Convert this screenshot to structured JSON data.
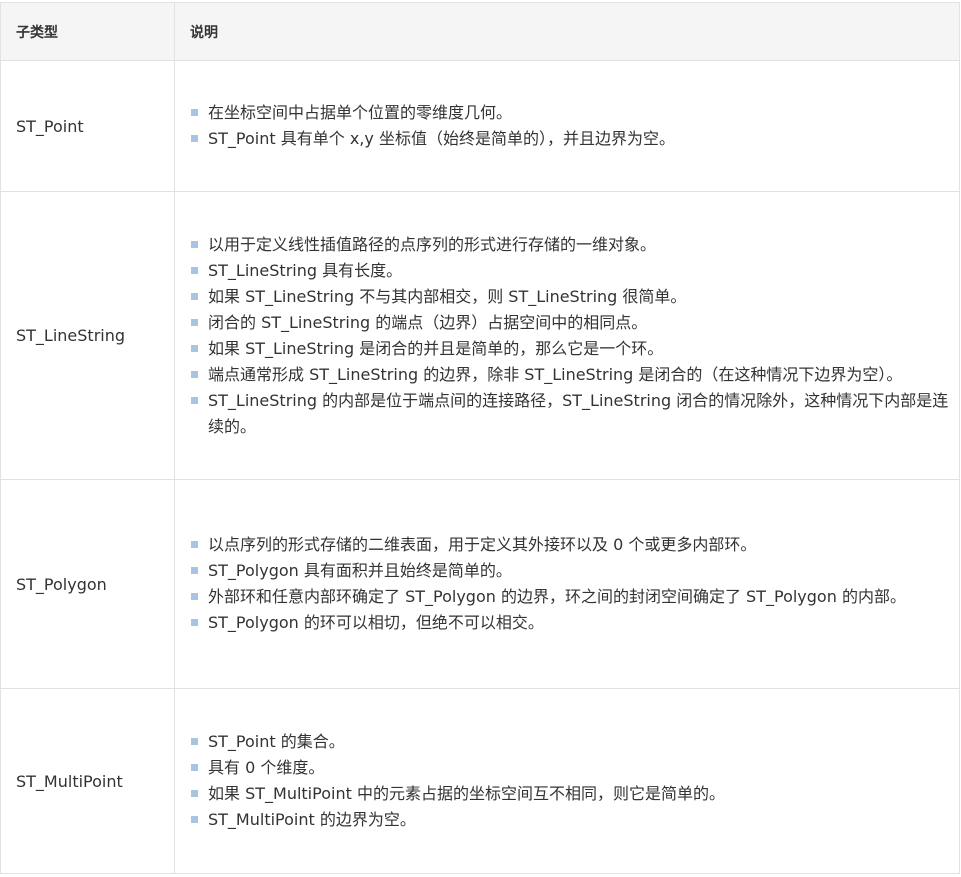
{
  "table": {
    "headers": [
      "子类型",
      "说明"
    ],
    "rows": [
      {
        "type": "ST_Point",
        "items": [
          "在坐标空间中占据单个位置的零维度几何。",
          "ST_Point 具有单个 x,y 坐标值（始终是简单的），并且边界为空。"
        ]
      },
      {
        "type": "ST_LineString",
        "items": [
          "以用于定义线性插值路径的点序列的形式进行存储的一维对象。",
          "ST_LineString 具有长度。",
          "如果 ST_LineString 不与其内部相交，则 ST_LineString 很简单。",
          "闭合的 ST_LineString 的端点（边界）占据空间中的相同点。",
          "如果 ST_LineString 是闭合的并且是简单的，那么它是一个环。",
          "端点通常形成 ST_LineString 的边界，除非 ST_LineString 是闭合的（在这种情况下边界为空）。",
          "ST_LineString 的内部是位于端点间的连接路径，ST_LineString 闭合的情况除外，这种情况下内部是连续的。"
        ]
      },
      {
        "type": "ST_Polygon",
        "items": [
          "以点序列的形式存储的二维表面，用于定义其外接环以及 0 个或更多内部环。",
          "ST_Polygon 具有面积并且始终是简单的。",
          "外部环和任意内部环确定了 ST_Polygon 的边界，环之间的封闭空间确定了 ST_Polygon 的内部。",
          "ST_Polygon 的环可以相切，但绝不可以相交。"
        ]
      },
      {
        "type": "ST_MultiPoint",
        "items": [
          "ST_Point 的集合。",
          "具有 0 个维度。",
          "如果 ST_MultiPoint 中的元素占据的坐标空间互不相同，则它是简单的。",
          "ST_MultiPoint 的边界为空。"
        ]
      }
    ]
  },
  "colors": {
    "header_bg": "#f5f5f5",
    "border": "#e2e2e2",
    "bullet": "#a8c4e0",
    "text": "#333333"
  }
}
